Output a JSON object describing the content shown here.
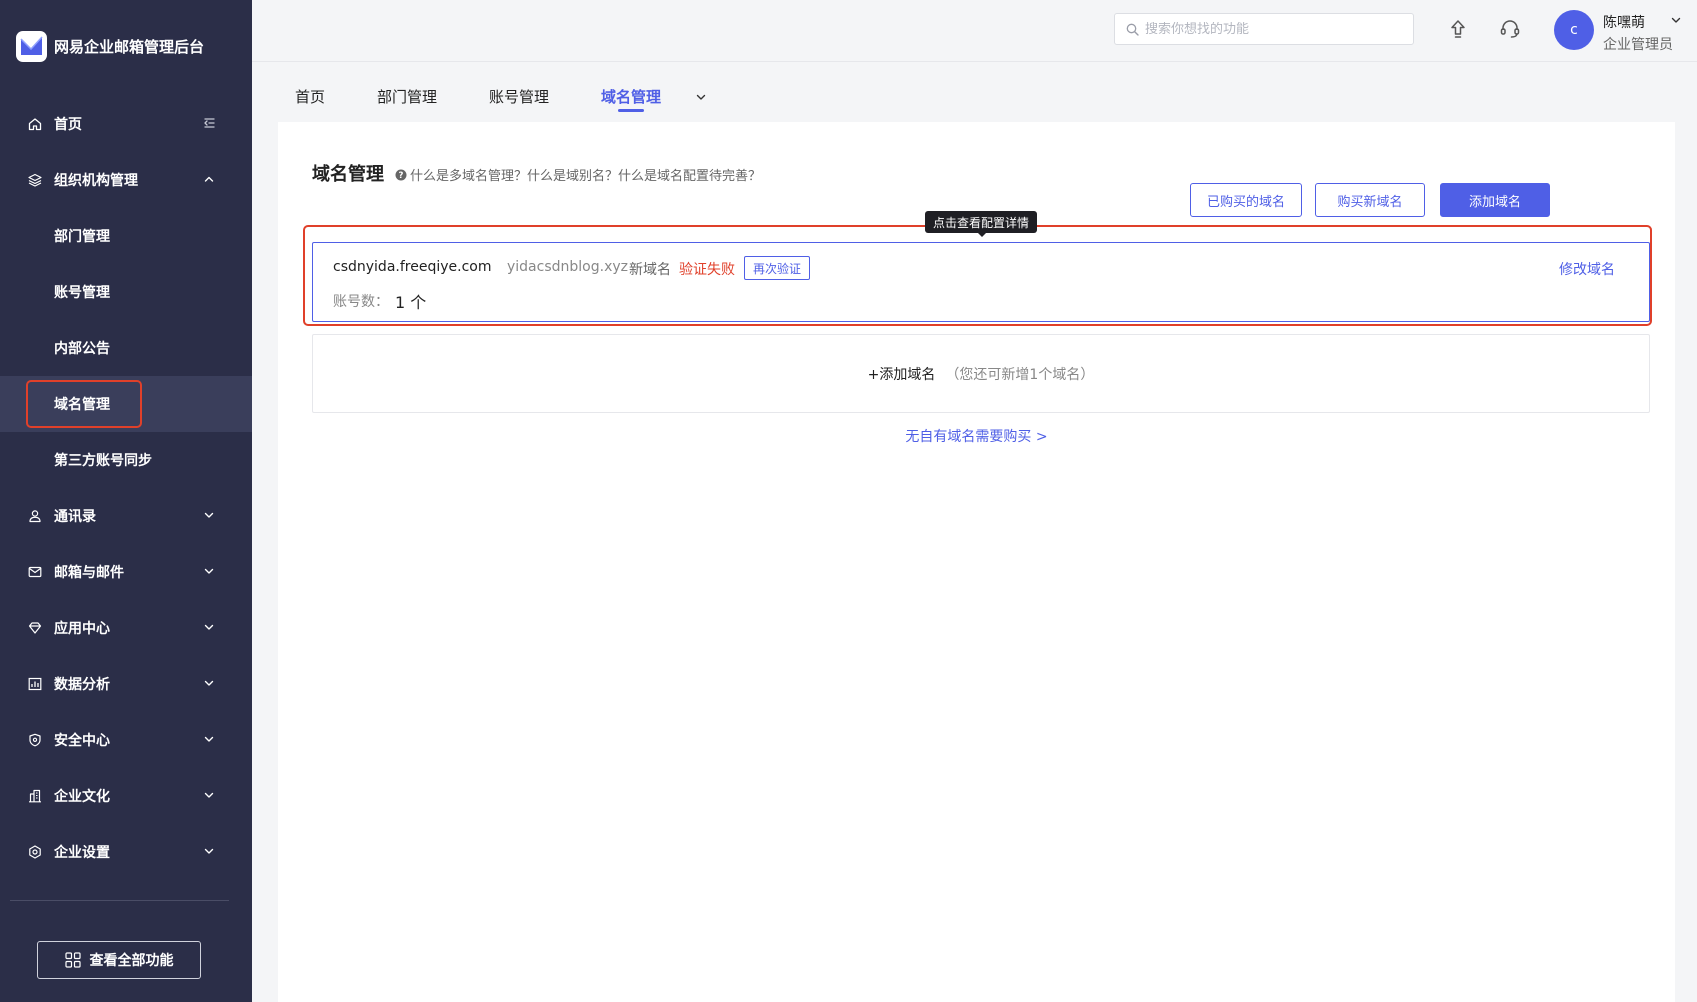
{
  "app": {
    "title": "网易企业邮箱管理后台"
  },
  "sidebar": {
    "items": [
      {
        "label": "首页",
        "icon": "home-icon",
        "arrow": "collapse-sidebar-icon"
      },
      {
        "label": "组织机构管理",
        "icon": "layers-icon",
        "arrow": "chevron-up-icon"
      },
      {
        "label": "部门管理"
      },
      {
        "label": "账号管理"
      },
      {
        "label": "内部公告"
      },
      {
        "label": "域名管理",
        "active": true
      },
      {
        "label": "第三方账号同步"
      },
      {
        "label": "通讯录",
        "icon": "user-icon",
        "arrow": "chevron-down-icon"
      },
      {
        "label": "邮箱与邮件",
        "icon": "mail-icon",
        "arrow": "chevron-down-icon"
      },
      {
        "label": "应用中心",
        "icon": "diamond-icon",
        "arrow": "chevron-down-icon"
      },
      {
        "label": "数据分析",
        "icon": "chart-icon",
        "arrow": "chevron-down-icon"
      },
      {
        "label": "安全中心",
        "icon": "shield-icon",
        "arrow": "chevron-down-icon"
      },
      {
        "label": "企业文化",
        "icon": "building-icon",
        "arrow": "chevron-down-icon"
      },
      {
        "label": "企业设置",
        "icon": "gear-icon",
        "arrow": "chevron-down-icon"
      }
    ],
    "all_functions_label": "查看全部功能"
  },
  "topbar": {
    "search_placeholder": "搜索你想找的功能",
    "avatar_letter": "c",
    "user_name": "陈嘿萌",
    "user_role": "企业管理员"
  },
  "tabs": [
    {
      "label": "首页"
    },
    {
      "label": "部门管理"
    },
    {
      "label": "账号管理"
    },
    {
      "label": "域名管理",
      "active": true
    }
  ],
  "main": {
    "title": "域名管理",
    "help_text": "什么是多域名管理？什么是域别名？什么是域名配置待完善？",
    "buttons": {
      "purchased": "已购买的域名",
      "buy_new": "购买新域名",
      "add": "添加域名"
    },
    "tooltip": "点击查看配置详情",
    "domain": {
      "name": "csdnyida.freeqiye.com",
      "alias": "yidacsdnblog.xyz",
      "tag": "新域名",
      "status": "验证失败",
      "reverify": "再次验证",
      "account_label": "账号数：",
      "account_count": "1 个",
      "edit": "修改域名"
    },
    "add_row": {
      "label": "+添加域名",
      "hint": "（您还可新增1个域名）"
    },
    "buy_link": "无自有域名需要购买 >"
  },
  "colors": {
    "sidebar_bg": "#2b2e48",
    "accent": "#4f5fe6",
    "error": "#e0402a",
    "highlight": "#e0402a"
  }
}
